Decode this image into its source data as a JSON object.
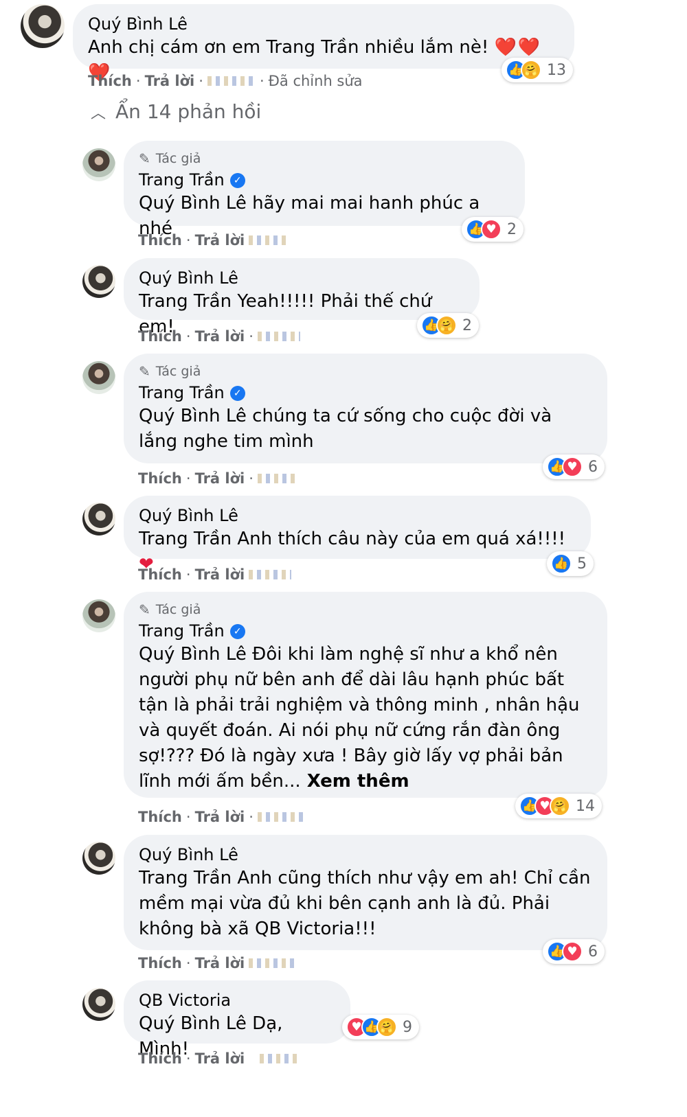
{
  "main_comment": {
    "author": "Quý Bình Lê",
    "text": "Anh chị cám ơn em Trang Trần nhiều lắm nè!",
    "hearts": "❤️❤️❤️",
    "like_label": "Thích",
    "reply_label": "Trả lời",
    "edited_label": "Đã chỉnh sửa",
    "reaction_count": "13"
  },
  "hide_replies_label": "Ẩn 14 phản hồi",
  "author_badge_label": "Tác giả",
  "action_like": "Thích",
  "action_reply": "Trả lời",
  "replies": [
    {
      "author": "Trang Trần",
      "is_author": true,
      "mention": "Quý Bình Lê",
      "text": " hãy mai mai hanh phúc a nhé",
      "reaction_count": "2"
    },
    {
      "author": "Quý Bình Lê",
      "is_author": false,
      "mention": "Trang Trần",
      "text": " Yeah!!!!! Phải thế chứ em!",
      "reaction_count": "2"
    },
    {
      "author": "Trang Trần",
      "is_author": true,
      "mention": "Quý Bình Lê",
      "text": " chúng ta cứ sống cho cuộc đời và lắng nghe tim mình",
      "reaction_count": "6"
    },
    {
      "author": "Quý Bình Lê",
      "is_author": false,
      "mention": "Trang Trần",
      "text": " Anh thích câu này của em quá xá!!!!",
      "reaction_count": "5"
    },
    {
      "author": "Trang Trần",
      "is_author": true,
      "mention": "Quý Bình Lê",
      "text": " Đôi khi làm nghệ sĩ như a khổ nên người phụ nữ bên anh để dài lâu hạnh phúc bất tận là phải trải nghiệm và thông minh , nhân hậu và quyết đoán. Ai nói phụ nữ cứng rắn đàn ông sợ!??? Đó là ngày xưa ! Bây giờ lấy vợ phải bản lĩnh mới ấm bền...",
      "see_more": " Xem thêm",
      "reaction_count": "14"
    },
    {
      "author": "Quý Bình Lê",
      "is_author": false,
      "mention": "Trang Trần",
      "text": " Anh cũng thích như vậy em ah! Chỉ cần mềm mại vừa đủ khi bên cạnh anh là đủ. Phải không bà xã ",
      "mention2": "QB Victoria",
      "text2": "!!!",
      "reaction_count": "6"
    },
    {
      "author": "QB Victoria",
      "is_author": false,
      "mention": "Quý Bình Lê",
      "text": " Dạ, Mình!",
      "reaction_count": "9"
    }
  ],
  "colors": {
    "like": "#1877f2",
    "love": "#f33e58",
    "care": "#f7b125",
    "bubble": "#f0f2f5",
    "meta": "#65676b"
  }
}
